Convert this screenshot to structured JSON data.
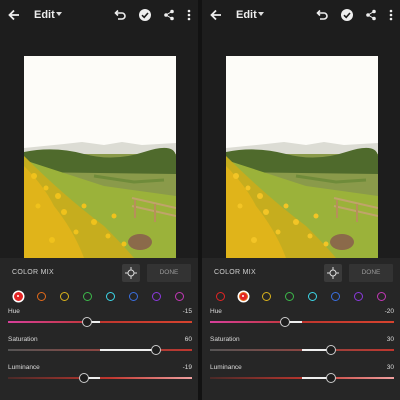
{
  "panels": [
    {
      "header": {
        "title": "Edit"
      },
      "color_mix": {
        "label": "COLOR MIX",
        "done_label": "DONE",
        "selected_swatch": 0,
        "sliders": [
          {
            "label": "Hue",
            "value": "-15",
            "level": -15
          },
          {
            "label": "Saturation",
            "value": "60",
            "level": 60
          },
          {
            "label": "Luminance",
            "value": "-19",
            "level": -19
          }
        ]
      }
    },
    {
      "header": {
        "title": "Edit"
      },
      "color_mix": {
        "label": "COLOR MIX",
        "done_label": "DONE",
        "selected_swatch": 1,
        "sliders": [
          {
            "label": "Hue",
            "value": "-20",
            "level": -20
          },
          {
            "label": "Saturation",
            "value": "30",
            "level": 30
          },
          {
            "label": "Luminance",
            "value": "30",
            "level": 30
          }
        ]
      }
    }
  ],
  "swatch_colors": [
    "#e32424",
    "#e36a1a",
    "#d9b21c",
    "#3cb84a",
    "#3cd7e8",
    "#3a6fe0",
    "#8a39dc",
    "#c238b6"
  ],
  "icons": [
    "back-arrow-icon",
    "caret-down-icon",
    "undo-icon",
    "check-icon",
    "share-icon",
    "more-vertical-icon",
    "target-adjust-icon"
  ]
}
